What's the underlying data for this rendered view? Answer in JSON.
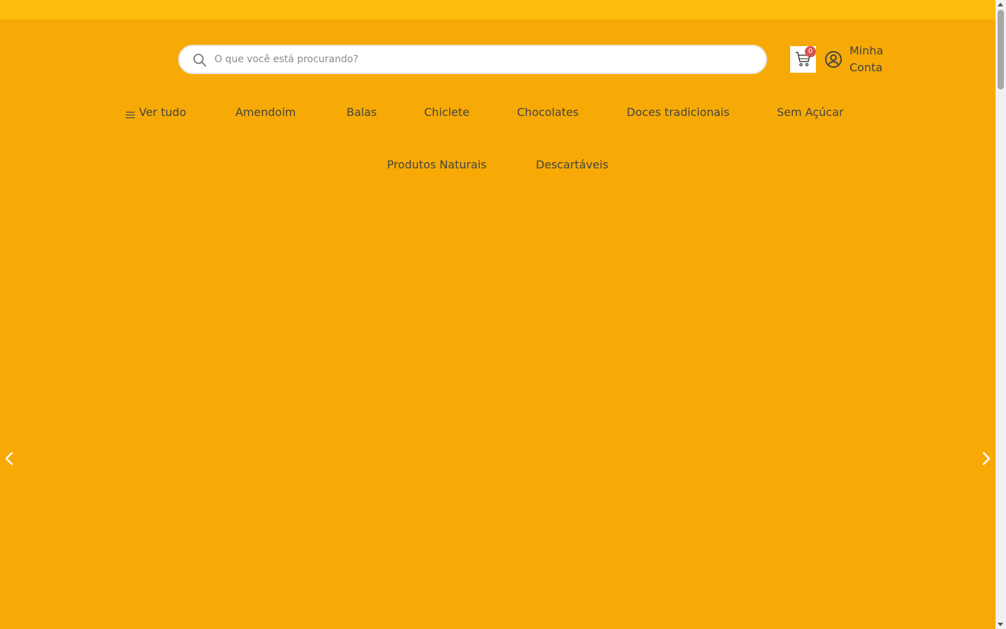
{
  "header": {
    "search": {
      "placeholder": "O que você está procurando?",
      "value": "",
      "icon": "search-icon"
    },
    "cart": {
      "icon": "cart-icon",
      "count": "0"
    },
    "account": {
      "icon": "user-circle-icon",
      "label_line1": "Minha",
      "label_line2": "Conta"
    }
  },
  "nav": {
    "menu_icon": "hamburger-icon",
    "items": [
      {
        "label": "Ver tudo"
      },
      {
        "label": "Amendoim"
      },
      {
        "label": "Balas"
      },
      {
        "label": "Chiclete"
      },
      {
        "label": "Chocolates"
      },
      {
        "label": "Doces tradicionais"
      },
      {
        "label": "Sem Açúcar"
      },
      {
        "label": "Produtos Naturais"
      },
      {
        "label": "Descartáveis"
      }
    ]
  },
  "carousel": {
    "prev_icon": "chevron-left-icon",
    "next_icon": "chevron-right-icon"
  },
  "colors": {
    "background": "#f7aa05",
    "top_strip": "#fdbb0c",
    "badge": "#d9534f",
    "text": "#444444"
  }
}
